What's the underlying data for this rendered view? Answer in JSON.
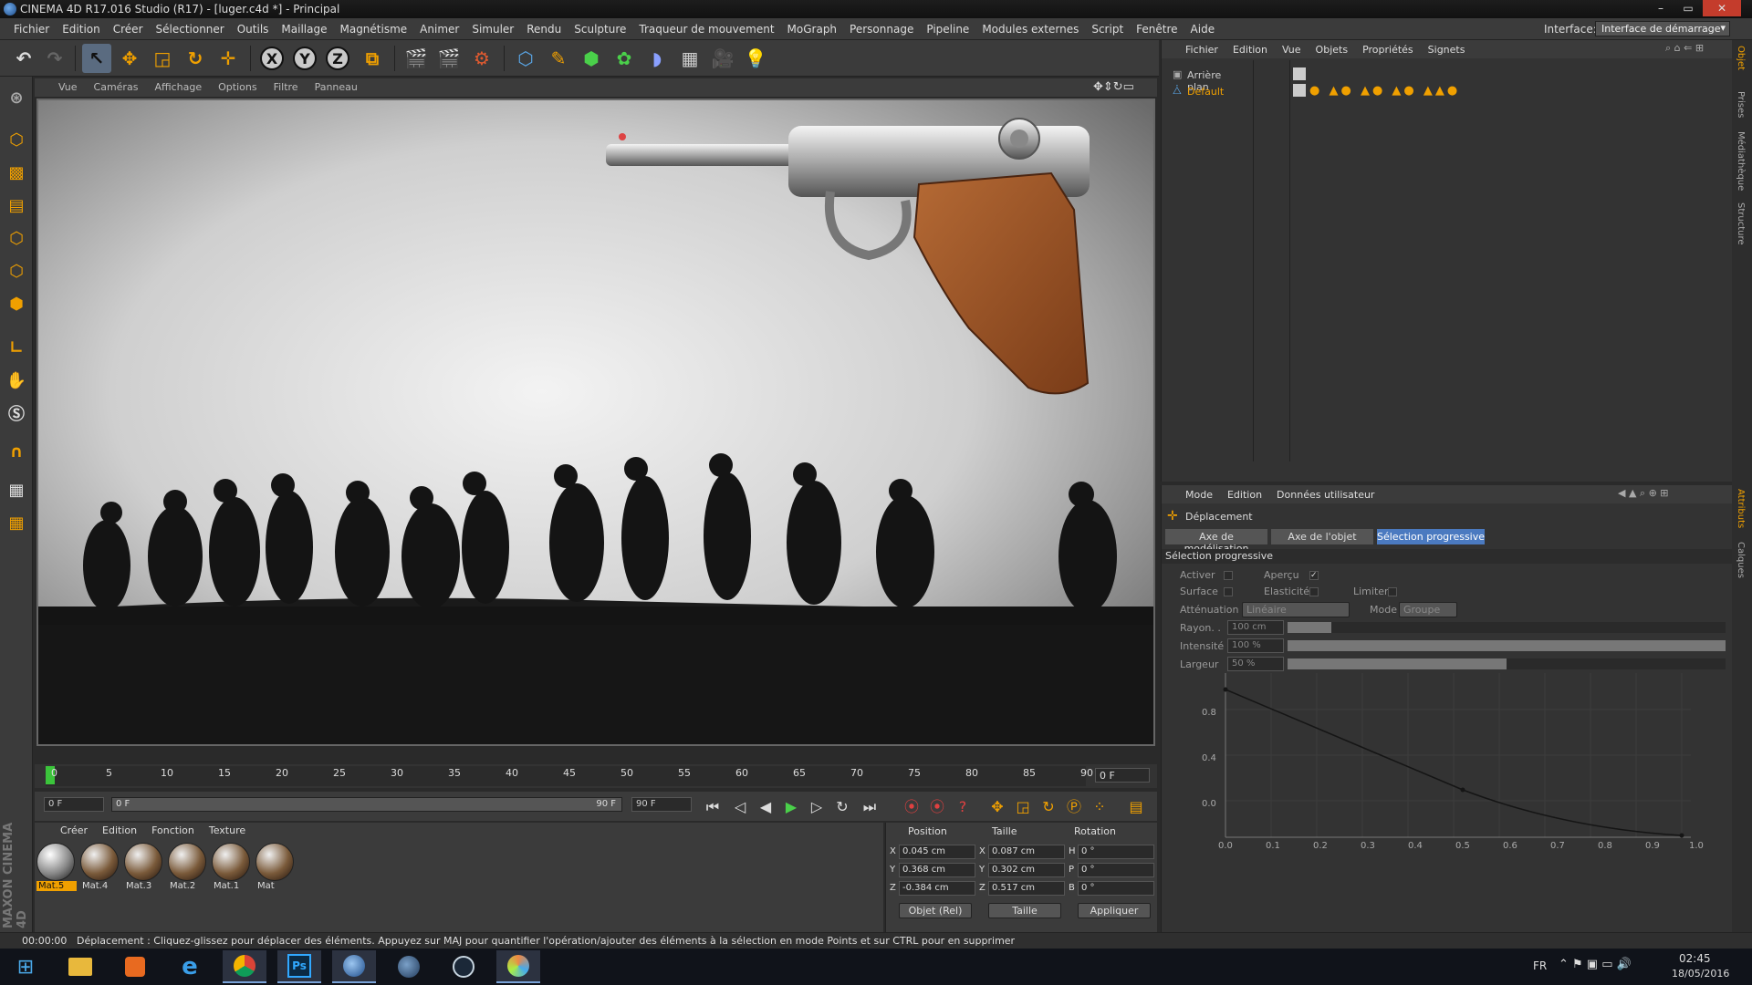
{
  "window": {
    "title": "CINEMA 4D R17.016 Studio (R17) - [luger.c4d *] - Principal",
    "minimize": "–",
    "maximize": "▭",
    "close": "✕"
  },
  "menubar": {
    "items": [
      "Fichier",
      "Edition",
      "Créer",
      "Sélectionner",
      "Outils",
      "Maillage",
      "Magnétisme",
      "Animer",
      "Simuler",
      "Rendu",
      "Sculpture",
      "Traqueur de mouvement",
      "MoGraph",
      "Personnage",
      "Pipeline",
      "Modules externes",
      "Script",
      "Fenêtre",
      "Aide"
    ],
    "interface_label": "Interface:",
    "interface_value": "Interface de démarrage"
  },
  "toolbar": {
    "axis_x": "X",
    "axis_y": "Y",
    "axis_z": "Z"
  },
  "viewport": {
    "menu": [
      "Vue",
      "Caméras",
      "Affichage",
      "Options",
      "Filtre",
      "Panneau"
    ]
  },
  "timeline": {
    "ticks": [
      "0",
      "5",
      "10",
      "15",
      "20",
      "25",
      "30",
      "35",
      "40",
      "45",
      "50",
      "55",
      "60",
      "65",
      "70",
      "75",
      "80",
      "85",
      "90"
    ],
    "current_frame": "0 F",
    "start": "0 F",
    "range_start": "0 F",
    "range_end": "90 F",
    "end": "90 F"
  },
  "materials": {
    "menu": [
      "Créer",
      "Edition",
      "Fonction",
      "Texture"
    ],
    "items": [
      "Mat.5",
      "Mat.4",
      "Mat.3",
      "Mat.2",
      "Mat.1",
      "Mat"
    ],
    "brand": "MAXON CINEMA 4D"
  },
  "coordinates": {
    "headers": [
      "Position",
      "Taille",
      "Rotation"
    ],
    "position": {
      "x": "0.045 cm",
      "y": "0.368 cm",
      "z": "-0.384 cm"
    },
    "size": {
      "x": "0.087 cm",
      "y": "0.302 cm",
      "z": "0.517 cm"
    },
    "rotation": {
      "h": "0 °",
      "p": "0 °",
      "b": "0 °"
    },
    "mode_select": "Objet (Rel)",
    "size_select": "Taille",
    "apply": "Appliquer"
  },
  "status": {
    "time": "00:00:00",
    "message": "Déplacement : Cliquez-glissez pour déplacer des éléments. Appuyez sur MAJ pour quantifier l'opération/ajouter des éléments à la sélection en mode Points et sur CTRL pour en supprimer"
  },
  "object_manager": {
    "menu": [
      "Fichier",
      "Edition",
      "Vue",
      "Objets",
      "Propriétés",
      "Signets"
    ],
    "objects": [
      {
        "name": "Arrière plan",
        "selected": false
      },
      {
        "name": "Default",
        "selected": true
      }
    ]
  },
  "attribute_manager": {
    "menu": [
      "Mode",
      "Edition",
      "Données utilisateur"
    ],
    "tool_name": "Déplacement",
    "tabs": [
      "Axe de modélisation",
      "Axe de l'objet",
      "Sélection progressive"
    ],
    "active_tab": 2,
    "section": "Sélection progressive",
    "options": {
      "activer": "Activer",
      "apercu": "Aperçu",
      "surface": "Surface",
      "elasticite": "Elasticité",
      "limiter": "Limiter",
      "attenuation_label": "Atténuation",
      "attenuation_value": "Linéaire",
      "mode_label": "Mode",
      "mode_value": "Groupe",
      "rayon_label": "Rayon. .",
      "rayon_value": "100 cm",
      "intensite_label": "Intensité",
      "intensite_value": "100 %",
      "largeur_label": "Largeur",
      "largeur_value": "50 %"
    },
    "sliders": {
      "rayon": 0.1,
      "intensite": 1.0,
      "largeur": 0.5
    },
    "curve": {
      "x_ticks": [
        "0.0",
        "0.1",
        "0.2",
        "0.3",
        "0.4",
        "0.5",
        "0.6",
        "0.7",
        "0.8",
        "0.9",
        "1.0"
      ],
      "y_ticks": [
        "0.8",
        "0.4",
        "0.0"
      ]
    }
  },
  "side_tabs": [
    "Objet",
    "Prises",
    "Médiathèque",
    "Structure",
    "Attributs",
    "Calques"
  ],
  "taskbar": {
    "lang": "FR",
    "time": "02:45",
    "date": "18/05/2016"
  }
}
